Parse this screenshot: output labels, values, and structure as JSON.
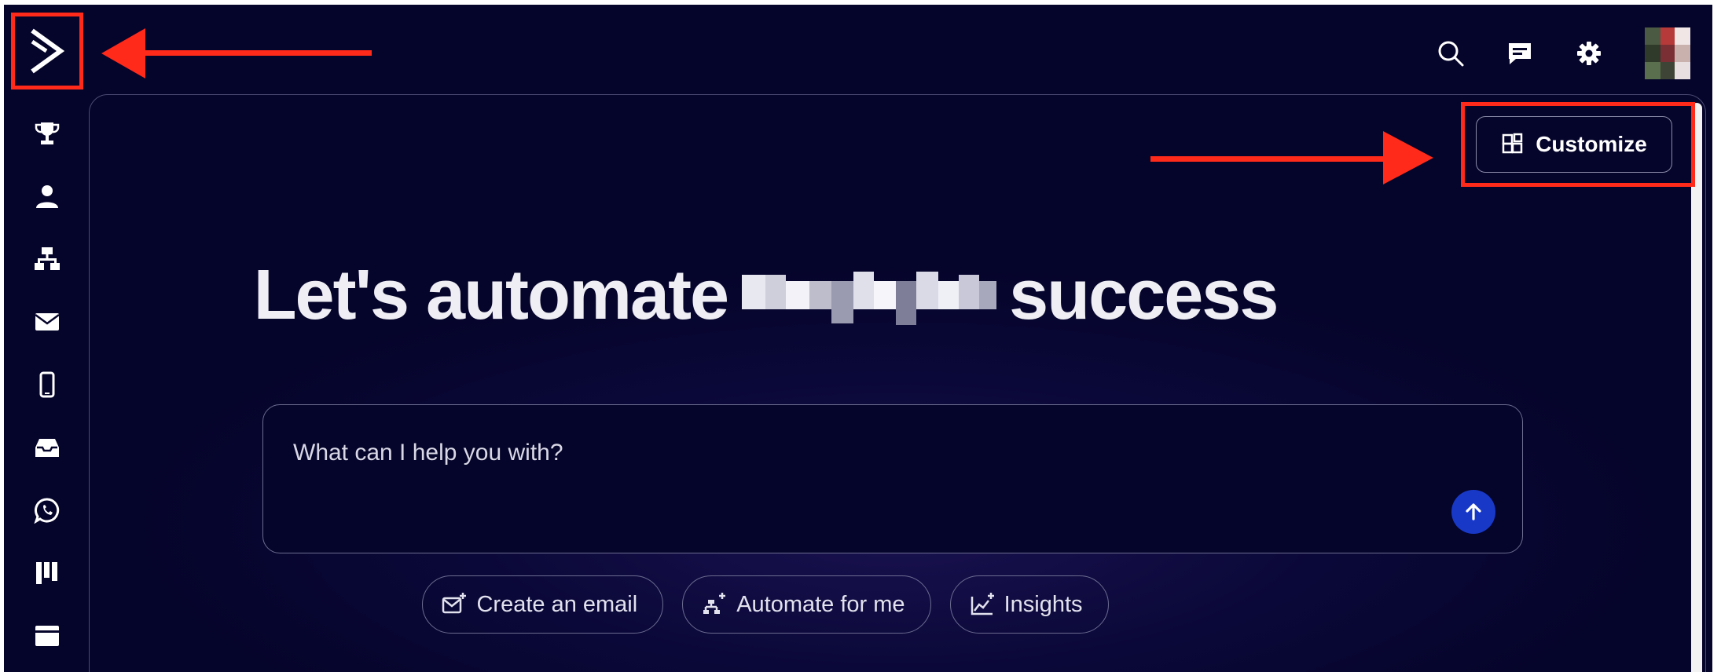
{
  "topbar": {
    "logo_icon": "activecampaign-chevron-logo",
    "icons": [
      "search-icon",
      "chat-icon",
      "settings-icon"
    ],
    "highlight_color": "#ff2a1a"
  },
  "sidebar": {
    "items": [
      {
        "icon": "trophy-icon"
      },
      {
        "icon": "contacts-icon"
      },
      {
        "icon": "automation-icon"
      },
      {
        "icon": "email-icon"
      },
      {
        "icon": "mobile-icon"
      },
      {
        "icon": "inbox-icon"
      },
      {
        "icon": "whatsapp-icon"
      },
      {
        "icon": "deals-pipeline-icon"
      },
      {
        "icon": "website-icon"
      }
    ]
  },
  "main": {
    "customize_label": "Customize",
    "headline_before": "Let's automate",
    "headline_after": "success",
    "prompt_placeholder": "What can I help you with?",
    "chips": [
      {
        "label": "Create an email",
        "icon": "email-sparkle-icon"
      },
      {
        "label": "Automate for me",
        "icon": "automation-sparkle-icon"
      },
      {
        "label": "Insights",
        "icon": "chart-sparkle-icon"
      }
    ]
  },
  "colors": {
    "background": "#05042a",
    "send_button": "#1839c8",
    "annotation": "#ff2a1a"
  }
}
